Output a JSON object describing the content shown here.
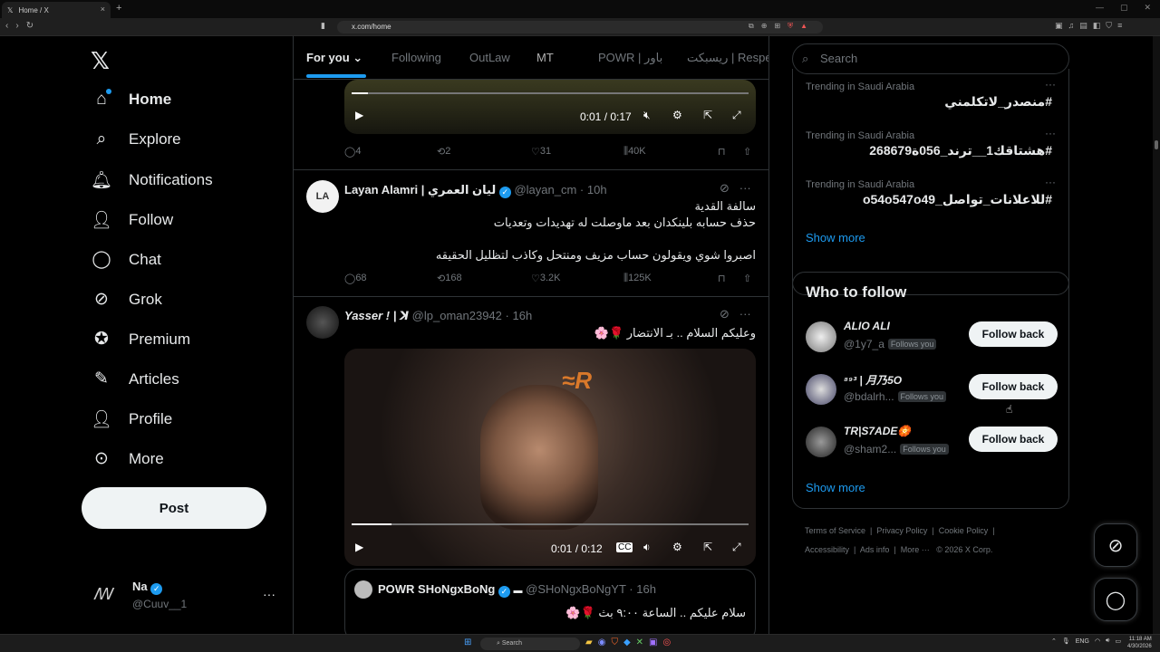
{
  "browser": {
    "tab_title": "Home / X",
    "tab_close": "×",
    "new_tab": "+",
    "url": "x.com/home",
    "window_controls": [
      "—",
      "▢",
      "✕"
    ],
    "nav_buttons": [
      "‹",
      "›",
      "↻"
    ]
  },
  "sidebar": {
    "logo": "𝕏",
    "items": [
      {
        "label": "Home",
        "icon": "home-icon",
        "glyph": "⌂"
      },
      {
        "label": "Explore",
        "icon": "search-icon",
        "glyph": "⌕"
      },
      {
        "label": "Notifications",
        "icon": "bell-icon",
        "glyph": "🔔︎"
      },
      {
        "label": "Follow",
        "icon": "person-add-icon",
        "glyph": "👤︎"
      },
      {
        "label": "Chat",
        "icon": "chat-icon",
        "glyph": "◯"
      },
      {
        "label": "Grok",
        "icon": "grok-icon",
        "glyph": "⊘"
      },
      {
        "label": "Premium",
        "icon": "premium-icon",
        "glyph": "✪"
      },
      {
        "label": "Articles",
        "icon": "articles-icon",
        "glyph": "✎"
      },
      {
        "label": "Profile",
        "icon": "profile-icon",
        "glyph": "👤︎"
      },
      {
        "label": "More",
        "icon": "more-icon",
        "glyph": "⊙"
      }
    ],
    "post_label": "Post",
    "account": {
      "logo": "ꟿ",
      "name": "Na",
      "handle": "@Cuuv__1",
      "more": "···"
    }
  },
  "feed_tabs": [
    "For you",
    "Following",
    "OutLaw",
    "MT",
    "POWR | باور",
    "ريسبكت | Respe"
  ],
  "tweets": [
    {
      "video": {
        "time": "0:01 / 0:17",
        "progress": 0.04
      },
      "stats": {
        "replies": "4",
        "reposts": "2",
        "likes": "31",
        "views": "40K"
      }
    },
    {
      "name": "Layan Alamri | ليان العمري",
      "handle": "@layan_cm",
      "time": "10h",
      "avatar_text": "LA",
      "lines": [
        "سالفة القدية",
        "حذف حسابه بلينكدان بعد ماوصلت له تهديدات وتعديات",
        "اصبروا شوي ويقولون حساب مزيف ومنتحل وكاذب لتظليل الحقيقه"
      ],
      "stats": {
        "replies": "68",
        "reposts": "168",
        "likes": "3.2K",
        "views": "125K"
      }
    },
    {
      "name": "Yasser ! | ꓘ",
      "handle": "@lp_oman23942",
      "time": "16h",
      "text": "وعليكم السلام .. بـ الانتضار 🌹🌸",
      "video": {
        "time": "0:01 / 0:12",
        "progress": 0.1
      },
      "quote": {
        "name": "POWR SHoNgxBoNg",
        "handle": "@SHoNgxBoNgYT",
        "time": "16h",
        "text": "سلام عليكم .. الساعة ٩:٠٠ بث 🌹🌸"
      }
    }
  ],
  "right": {
    "search_placeholder": "Search",
    "trends": [
      {
        "location": "Trending in Saudi Arabia",
        "tag": "#منصدر_لاتكلمني"
      },
      {
        "location": "Trending in Saudi Arabia",
        "tag": "#هشتاقك1__ترند_056ة268679"
      },
      {
        "location": "Trending in Saudi Arabia",
        "tag": "#للاعلانات_تواصل_o54o547o49"
      }
    ],
    "show_more": "Show more",
    "who_to_follow": {
      "title": "Who to follow",
      "accounts": [
        {
          "name": "ALIO ALI",
          "handle": "@1y7_a",
          "badge": "Follows you",
          "button": "Follow back"
        },
        {
          "name": "⁸⁹³ | 月乃5O",
          "handle": "@bdalrh...",
          "badge": "Follows you",
          "button": "Follow back"
        },
        {
          "name": "TR|S7ADE🏵️",
          "handle": "@sham2...",
          "badge": "Follows you",
          "button": "Follow back"
        }
      ],
      "show_more": "Show more"
    },
    "footer": {
      "line1": [
        "Terms of Service",
        "Privacy Policy",
        "Cookie Policy"
      ],
      "line2": [
        "Accessibility",
        "Ads info",
        "More ···",
        "© 2026 X Corp."
      ]
    }
  },
  "taskbar": {
    "search": "Search",
    "lang": "ENG",
    "time": "11:18 AM",
    "date": "4/30/2026"
  },
  "colors": {
    "accent": "#1d9bf0",
    "background": "#000000",
    "border": "#2f3336",
    "muted": "#71767b"
  }
}
